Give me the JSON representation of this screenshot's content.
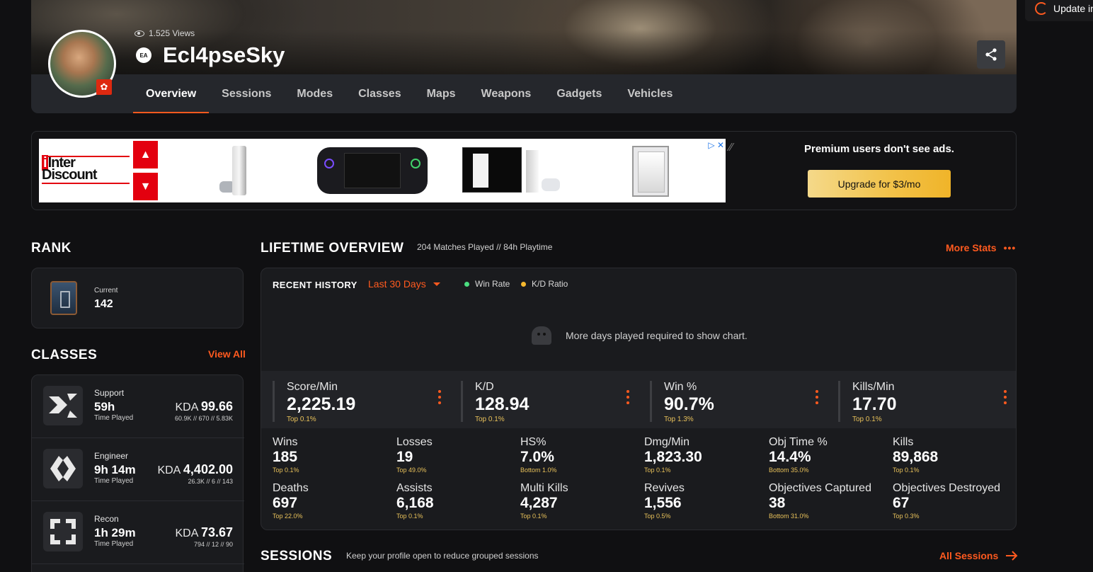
{
  "notification": {
    "label": "Update in"
  },
  "profile": {
    "views": "1.525 Views",
    "username": "Ecl4pseSky",
    "platform_badge": "EA"
  },
  "tabs": [
    "Overview",
    "Sessions",
    "Modes",
    "Classes",
    "Maps",
    "Weapons",
    "Gadgets",
    "Vehicles"
  ],
  "ad": {
    "brand_line1": "Inter",
    "brand_line2": "Discount",
    "premium_text": "Premium users don't see ads.",
    "upgrade_label": "Upgrade for $3/mo"
  },
  "rank": {
    "title": "RANK",
    "current_label": "Current",
    "current_value": "142"
  },
  "classes": {
    "title": "CLASSES",
    "view_all": "View All",
    "items": [
      {
        "name": "Support",
        "time": "59h",
        "time_label": "Time Played",
        "kda_label": "KDA",
        "kda": "99.66",
        "detail": "60.9K // 670 // 5.83K"
      },
      {
        "name": "Engineer",
        "time": "9h 14m",
        "time_label": "Time Played",
        "kda_label": "KDA",
        "kda": "4,402.00",
        "detail": "26.3K // 6 // 143"
      },
      {
        "name": "Recon",
        "time": "1h 29m",
        "time_label": "Time Played",
        "kda_label": "KDA",
        "kda": "73.67",
        "detail": "794 // 12 // 90"
      }
    ]
  },
  "lifetime": {
    "title": "LIFETIME OVERVIEW",
    "subtitle": "204 Matches Played // 84h Playtime",
    "more_stats": "More Stats",
    "recent_history": "RECENT HISTORY",
    "range": "Last 30 Days",
    "legend": [
      {
        "label": "Win Rate",
        "color": "#4ade80"
      },
      {
        "label": "K/D Ratio",
        "color": "#f5b82e"
      }
    ],
    "no_chart_msg": "More days played required to show chart.",
    "big_stats": [
      {
        "label": "Score/Min",
        "value": "2,225.19",
        "rank": "Top 0.1%"
      },
      {
        "label": "K/D",
        "value": "128.94",
        "rank": "Top 0.1%"
      },
      {
        "label": "Win %",
        "value": "90.7%",
        "rank": "Top 1.3%"
      },
      {
        "label": "Kills/Min",
        "value": "17.70",
        "rank": "Top 0.1%"
      }
    ],
    "stats": [
      {
        "label": "Wins",
        "value": "185",
        "rank": "Top 0.1%"
      },
      {
        "label": "Losses",
        "value": "19",
        "rank": "Top 49.0%"
      },
      {
        "label": "HS%",
        "value": "7.0%",
        "rank": "Bottom 1.0%"
      },
      {
        "label": "Dmg/Min",
        "value": "1,823.30",
        "rank": "Top 0.1%"
      },
      {
        "label": "Obj Time %",
        "value": "14.4%",
        "rank": "Bottom 35.0%"
      },
      {
        "label": "Kills",
        "value": "89,868",
        "rank": "Top 0.1%"
      },
      {
        "label": "Deaths",
        "value": "697",
        "rank": "Top 22.0%"
      },
      {
        "label": "Assists",
        "value": "6,168",
        "rank": "Top 0.1%"
      },
      {
        "label": "Multi Kills",
        "value": "4,287",
        "rank": "Top 0.1%"
      },
      {
        "label": "Revives",
        "value": "1,556",
        "rank": "Top 0.5%"
      },
      {
        "label": "Objectives Captured",
        "value": "38",
        "rank": "Bottom 31.0%"
      },
      {
        "label": "Objectives Destroyed",
        "value": "67",
        "rank": "Top 0.3%"
      }
    ]
  },
  "sessions": {
    "title": "SESSIONS",
    "subtitle": "Keep your profile open to reduce grouped sessions",
    "all_sessions": "All Sessions"
  }
}
